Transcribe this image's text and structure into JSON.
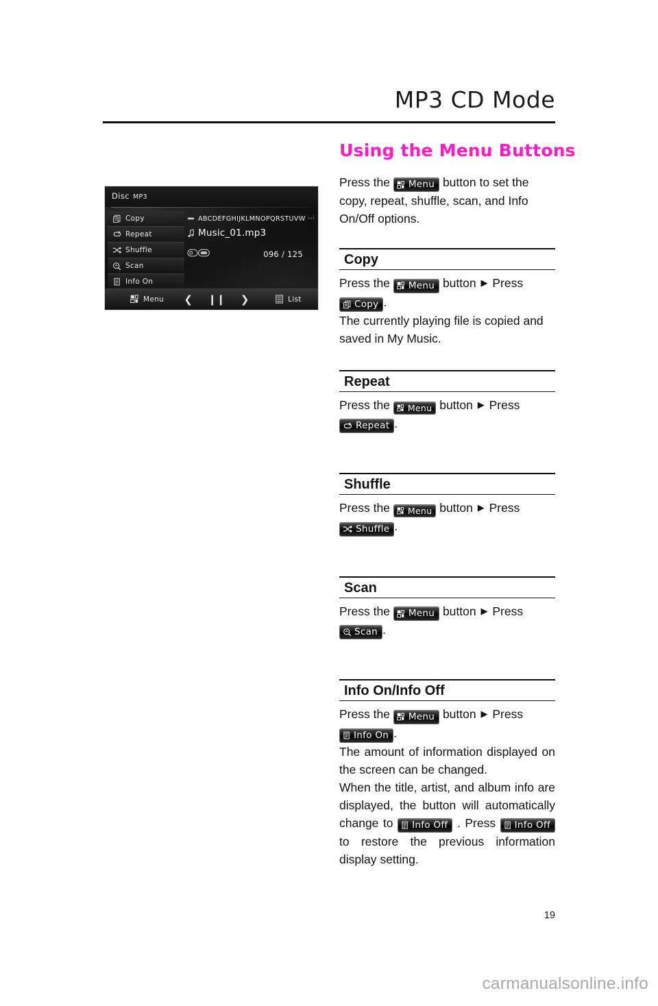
{
  "header": {
    "title": "MP3 CD Mode"
  },
  "device_screen": {
    "source_label": "Disc",
    "format_label": "MP3",
    "menu_items": [
      {
        "icon": "copy-icon",
        "label": "Copy"
      },
      {
        "icon": "repeat-icon",
        "label": "Repeat"
      },
      {
        "icon": "shuffle-icon",
        "label": "Shuffle"
      },
      {
        "icon": "scan-icon",
        "label": "Scan"
      },
      {
        "icon": "info-icon",
        "label": "Info On"
      }
    ],
    "album_line": "ABCDEFGHIJKLMNOPQRSTUVW ···",
    "track_line": "Music_01.mp3",
    "track_count": "096 / 125",
    "bottom_bar": {
      "menu_label": "Menu",
      "prev_glyph": "❮",
      "pause_glyph": "❙❙",
      "next_glyph": "❯",
      "list_label": "List"
    }
  },
  "main": {
    "section_heading": "Using the Menu Buttons",
    "intro": {
      "before_chip": "Press the",
      "chip": "Menu",
      "after_chip": "button to set the copy, repeat, shuffle, scan, and Info On/Off options."
    },
    "blocks": [
      {
        "title": "Copy",
        "press_the": "Press the",
        "menu_chip": "Menu",
        "button_word": "button",
        "arrow": "▶",
        "press_word": "Press",
        "action_chip": "Copy",
        "action_icon": "copy-icon",
        "period": ".",
        "description": "The currently playing file is copied and saved in My Music."
      },
      {
        "title": "Repeat",
        "press_the": "Press the",
        "menu_chip": "Menu",
        "button_word": "button",
        "arrow": "▶",
        "press_word": "Press",
        "action_chip": "Repeat",
        "action_icon": "repeat-icon",
        "period": ".",
        "description": ""
      },
      {
        "title": "Shuffle",
        "press_the": "Press the",
        "menu_chip": "Menu",
        "button_word": "button",
        "arrow": "▶",
        "press_word": "Press",
        "action_chip": "Shuffle",
        "action_icon": "shuffle-icon",
        "period": ".",
        "description": ""
      },
      {
        "title": "Scan",
        "press_the": "Press the",
        "menu_chip": "Menu",
        "button_word": "button",
        "arrow": "▶",
        "press_word": "Press",
        "action_chip": "Scan",
        "action_icon": "scan-icon",
        "period": ".",
        "description": ""
      },
      {
        "title": "Info On/Info Off",
        "press_the": "Press the",
        "menu_chip": "Menu",
        "button_word": "button",
        "arrow": "▶",
        "press_word": "Press",
        "action_chip": "Info On",
        "action_icon": "info-icon",
        "period": ".",
        "description": "The amount of information displayed on the screen can be changed.",
        "description2_a": "When the title, artist, and album info are displayed, the button will automatically change to",
        "info_off_chip": "Info Off",
        "description2_b": ". Press",
        "info_off_chip2": "Info Off",
        "description2_c": "to restore the previous information display setting."
      }
    ]
  },
  "footer": {
    "page_number": "19",
    "watermark": "carmanualsonline.info"
  },
  "colors": {
    "accent_pink": "#ff19c8",
    "text": "#111111",
    "watermark": "#a8a8a8"
  }
}
